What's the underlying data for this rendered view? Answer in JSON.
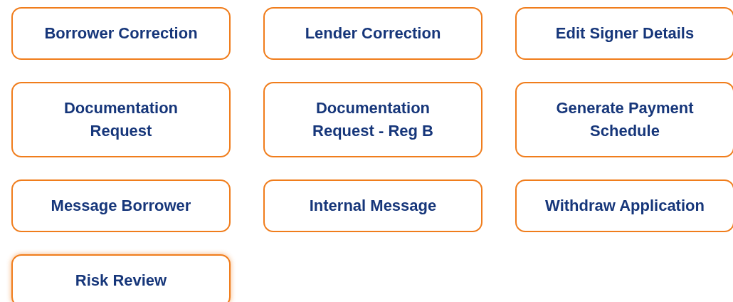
{
  "actions": [
    {
      "label": "Borrower Correction",
      "focused": false
    },
    {
      "label": "Lender Correction",
      "focused": false
    },
    {
      "label": "Edit Signer Details",
      "focused": false
    },
    {
      "label": "Documentation\nRequest",
      "focused": false
    },
    {
      "label": "Documentation\nRequest - Reg B",
      "focused": false
    },
    {
      "label": "Generate Payment\nSchedule",
      "focused": false
    },
    {
      "label": "Message Borrower",
      "focused": false
    },
    {
      "label": "Internal Message",
      "focused": false
    },
    {
      "label": "Withdraw Application",
      "focused": false
    },
    {
      "label": "Risk Review",
      "focused": true
    }
  ]
}
